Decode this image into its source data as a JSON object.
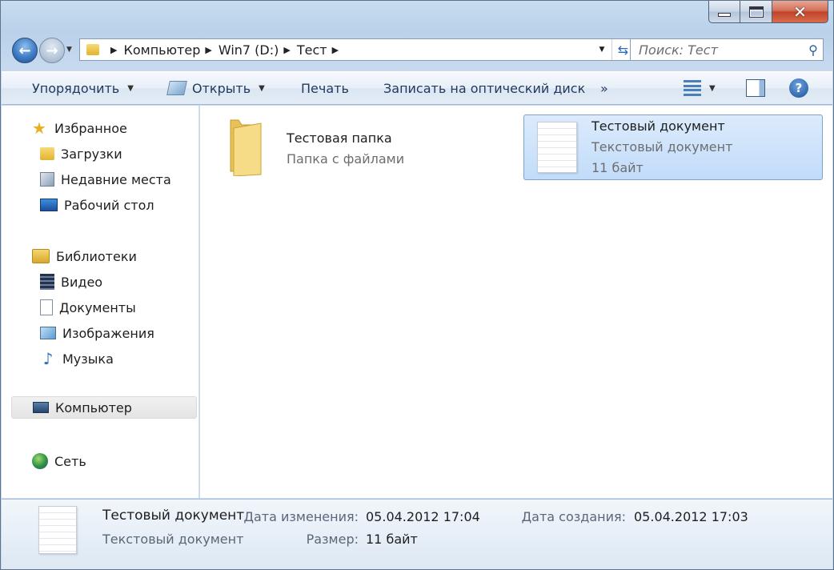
{
  "window": {
    "caption_buttons": {
      "minimize": "minimize",
      "maximize": "maximize",
      "close": "close"
    }
  },
  "navigation": {
    "breadcrumbs": [
      "Компьютер",
      "Win7 (D:)",
      "Тест"
    ],
    "search_placeholder": "Поиск: Тест"
  },
  "toolbar": {
    "organize": "Упорядочить",
    "open": "Открыть",
    "print": "Печать",
    "burn": "Записать на оптический диск",
    "more": "»"
  },
  "sidebar": {
    "favorites": {
      "label": "Избранное",
      "items": [
        "Загрузки",
        "Недавние места",
        "Рабочий стол"
      ]
    },
    "libraries": {
      "label": "Библиотеки",
      "items": [
        "Видео",
        "Документы",
        "Изображения",
        "Музыка"
      ]
    },
    "computer": "Компьютер",
    "network": "Сеть"
  },
  "files": [
    {
      "name": "Тестовая папка",
      "line2": "Папка с файлами",
      "line3": ""
    },
    {
      "name": "Тестовый документ",
      "line2": "Текстовый документ",
      "line3": "11 байт"
    }
  ],
  "details": {
    "name": "Тестовый документ",
    "type": "Текстовый документ",
    "modified_label": "Дата изменения:",
    "modified_value": "05.04.2012 17:04",
    "size_label": "Размер:",
    "size_value": "11 байт",
    "created_label": "Дата создания:",
    "created_value": "05.04.2012 17:03"
  },
  "colors": {
    "selection": "#c1dcfa",
    "accent": "#1e395b"
  }
}
